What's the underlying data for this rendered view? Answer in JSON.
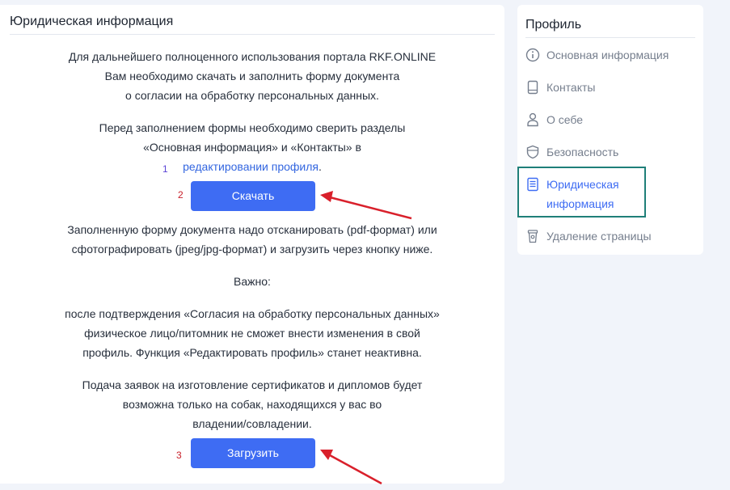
{
  "main": {
    "title": "Юридическая информация",
    "intro": [
      "Для дальнейшего полноценного использования портала RKF.ONLINE",
      "Вам необходимо скачать и заполнить форму документа",
      "о согласии на обработку персональных данных."
    ],
    "check": [
      "Перед заполнением формы необходимо сверить разделы",
      "«Основная информация» и «Контакты» в"
    ],
    "check_link": "редактировании профиля",
    "check_end": ".",
    "download_button": "Скачать",
    "scan": [
      "Заполненную форму документа надо отсканировать (pdf-формат) или",
      "сфотографировать (jpeg/jpg-формат) и загрузить через кнопку ниже."
    ],
    "important": "Важно:",
    "consent": [
      "после подтверждения «Согласия на обработку персональных данных»",
      "физическое лицо/питомник не сможет внести изменения в свой",
      "профиль. Функция «Редактировать профиль» станет неактивна."
    ],
    "applications": [
      "Подача заявок на изготовление сертификатов и дипломов будет",
      "возможна только на собак, находящихся у вас во",
      "владении/совладении."
    ],
    "upload_button": "Загрузить",
    "markers": [
      "1",
      "2",
      "3"
    ],
    "colors": {
      "accent": "#3e6cf3",
      "marker_red": "#c8202a",
      "active_box": "#1f7f79"
    }
  },
  "sidebar": {
    "title": "Профиль",
    "items": [
      {
        "label": "Основная информация",
        "icon": "info-icon"
      },
      {
        "label": "Контакты",
        "icon": "phone-icon"
      },
      {
        "label": "О себе",
        "icon": "user-icon"
      },
      {
        "label": "Безопасность",
        "icon": "shield-icon"
      },
      {
        "label": "Юридическая информация",
        "icon": "document-icon",
        "active": true
      },
      {
        "label": "Удаление страницы",
        "icon": "trash-icon"
      }
    ]
  }
}
